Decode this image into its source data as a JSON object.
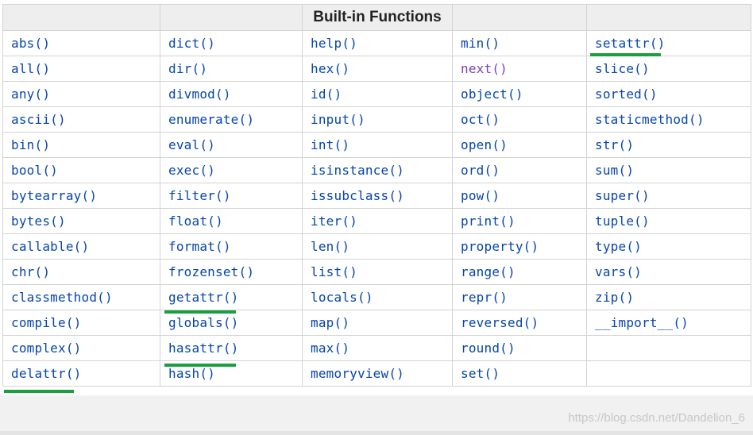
{
  "table": {
    "header": [
      "",
      "",
      "Built-in Functions",
      "",
      ""
    ],
    "rows": [
      [
        "abs()",
        "dict()",
        "help()",
        "min()",
        "setattr()"
      ],
      [
        "all()",
        "dir()",
        "hex()",
        "next()",
        "slice()"
      ],
      [
        "any()",
        "divmod()",
        "id()",
        "object()",
        "sorted()"
      ],
      [
        "ascii()",
        "enumerate()",
        "input()",
        "oct()",
        "staticmethod()"
      ],
      [
        "bin()",
        "eval()",
        "int()",
        "open()",
        "str()"
      ],
      [
        "bool()",
        "exec()",
        "isinstance()",
        "ord()",
        "sum()"
      ],
      [
        "bytearray()",
        "filter()",
        "issubclass()",
        "pow()",
        "super()"
      ],
      [
        "bytes()",
        "float()",
        "iter()",
        "print()",
        "tuple()"
      ],
      [
        "callable()",
        "format()",
        "len()",
        "property()",
        "type()"
      ],
      [
        "chr()",
        "frozenset()",
        "list()",
        "range()",
        "vars()"
      ],
      [
        "classmethod()",
        "getattr()",
        "locals()",
        "repr()",
        "zip()"
      ],
      [
        "compile()",
        "globals()",
        "map()",
        "reversed()",
        "__import__()"
      ],
      [
        "complex()",
        "hasattr()",
        "max()",
        "round()",
        ""
      ],
      [
        "delattr()",
        "hash()",
        "memoryview()",
        "set()",
        ""
      ]
    ],
    "visited_link": "next()",
    "highlighted": [
      "setattr()",
      "getattr()",
      "hasattr()",
      "delattr()"
    ],
    "highlight_color": "#1b9e3e",
    "link_color": "#0645ad",
    "visited_color": "#7a3fb8"
  },
  "watermark": "https://blog.csdn.net/Dandelion_6"
}
